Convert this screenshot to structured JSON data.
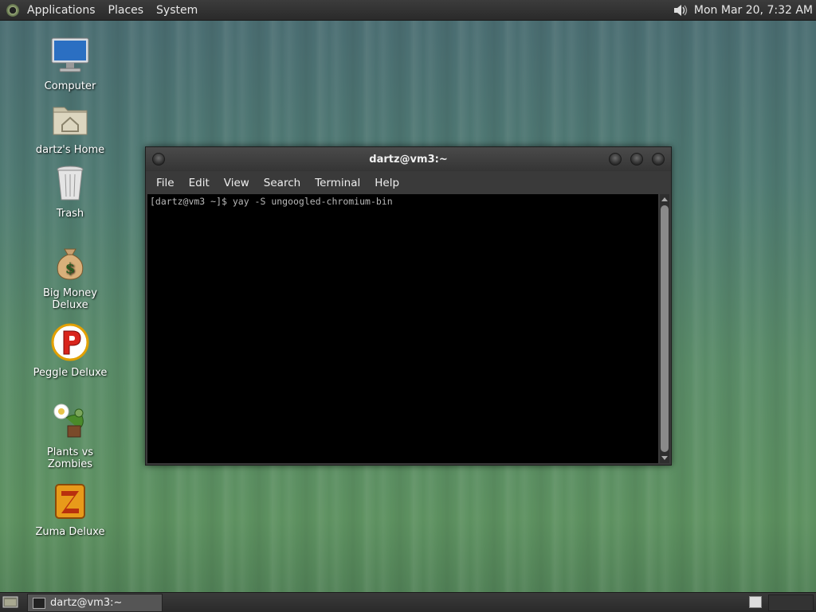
{
  "top_panel": {
    "menus": [
      "Applications",
      "Places",
      "System"
    ],
    "clock": "Mon Mar 20, 7:32 AM"
  },
  "desktop_icons": [
    {
      "label": "Computer",
      "icon": "computer-icon"
    },
    {
      "label": "dartz's Home",
      "icon": "home-folder-icon"
    },
    {
      "label": "Trash",
      "icon": "trash-icon"
    },
    {
      "label": "Big Money Deluxe",
      "icon": "money-bag-icon"
    },
    {
      "label": "Peggle Deluxe",
      "icon": "peggle-icon"
    },
    {
      "label": "Plants vs Zombies",
      "icon": "plants-vs-zombies-icon"
    },
    {
      "label": "Zuma Deluxe",
      "icon": "zuma-icon"
    }
  ],
  "terminal": {
    "title": "dartz@vm3:~",
    "menu": [
      "File",
      "Edit",
      "View",
      "Search",
      "Terminal",
      "Help"
    ],
    "line": "[dartz@vm3 ~]$ yay -S ungoogled-chromium-bin"
  },
  "bottom_panel": {
    "task_label": "dartz@vm3:~"
  }
}
